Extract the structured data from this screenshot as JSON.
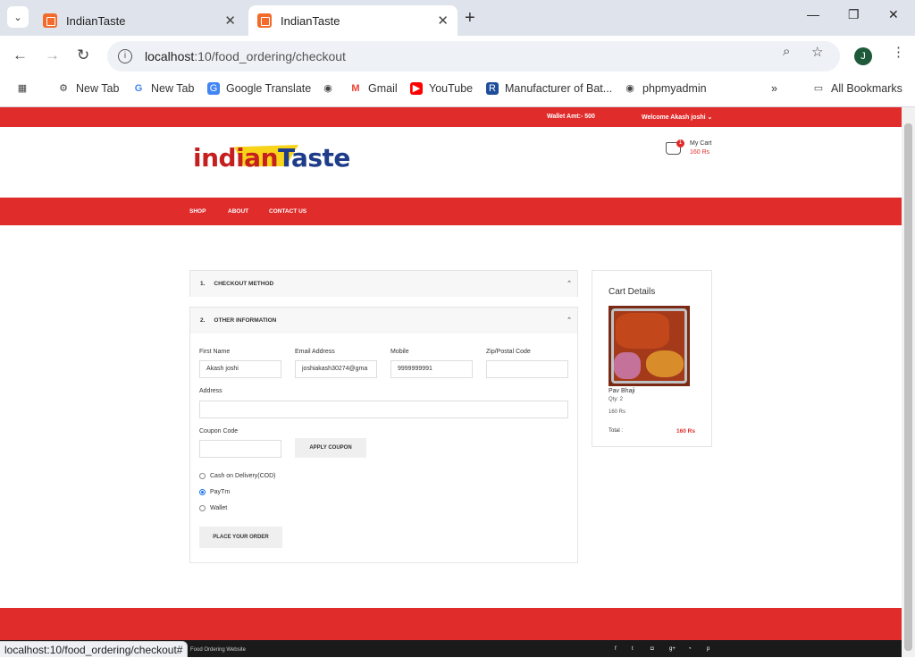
{
  "browser": {
    "tabs": [
      {
        "title": "IndianTaste",
        "active": false
      },
      {
        "title": "IndianTaste",
        "active": true
      }
    ],
    "url_host": "localhost",
    "url_path": ":10/food_ordering/checkout",
    "profile_initial": "J",
    "bookmarks": [
      "New Tab",
      "New Tab",
      "Google Translate",
      "Gmail",
      "YouTube",
      "Manufacturer of Bat...",
      "phpmyadmin"
    ],
    "all_bookmarks": "All Bookmarks",
    "status_url": "localhost:10/food_ordering/checkout#"
  },
  "site": {
    "wallet": "Wallet Amt:- 500",
    "welcome": "Welcome Akash joshi",
    "logo_part1": "indian",
    "logo_part2": "Taste",
    "cart_count": "1",
    "cart_label": "My Cart",
    "cart_total": "160 Rs",
    "nav": [
      "SHOP",
      "ABOUT",
      "CONTACT US"
    ]
  },
  "checkout": {
    "step1_num": "1.",
    "step1": "CHECKOUT METHOD",
    "step2_num": "2.",
    "step2": "OTHER INFORMATION",
    "labels": {
      "first_name": "First Name",
      "email": "Email Address",
      "mobile": "Mobile",
      "zip": "Zip/Postal Code",
      "address": "Address",
      "coupon": "Coupon Code"
    },
    "values": {
      "first_name": "Akash joshi",
      "email": "joshiakash30274@gma",
      "mobile": "9999999991",
      "zip": "",
      "address": "",
      "coupon": ""
    },
    "apply_coupon": "APPLY COUPON",
    "payment_options": [
      "Cash on Delivery(COD)",
      "PayTm",
      "Wallet"
    ],
    "selected_payment": "PayTm",
    "place_order": "PLACE YOUR ORDER"
  },
  "cart_details": {
    "title": "Cart Details",
    "item_name": "Pav Bhaji",
    "qty": "Qty: 2",
    "price": "160 Rs",
    "total_label": "Total :",
    "total_value": "160 Rs"
  },
  "footer": {
    "text": "Food Ordering Website"
  },
  "colors": {
    "brand_red": "#e12c2c",
    "logo_blue": "#1e3c8a"
  }
}
